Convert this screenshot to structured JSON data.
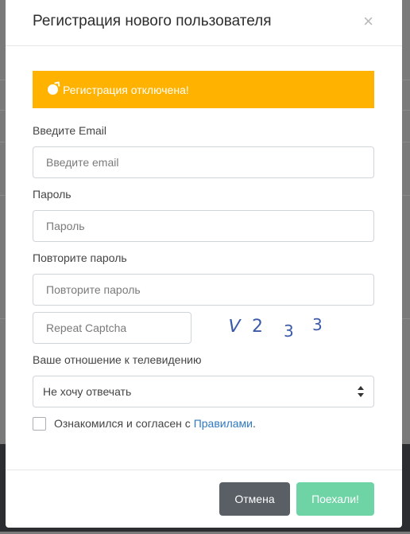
{
  "modal": {
    "title": "Регистрация нового пользователя",
    "close_label": "×"
  },
  "alert": {
    "icon": "bomb-icon",
    "text": "Регистрация отключена!",
    "color": "#ffb300"
  },
  "form": {
    "email": {
      "label": "Введите Email",
      "placeholder": "Введите email",
      "value": ""
    },
    "password": {
      "label": "Пароль",
      "placeholder": "Пароль",
      "value": ""
    },
    "password_repeat": {
      "label": "Повторите пароль",
      "placeholder": "Повторите пароль",
      "value": ""
    },
    "captcha": {
      "placeholder": "Repeat Captcha",
      "image_chars": [
        "V",
        "2",
        "3",
        "3"
      ]
    },
    "tv_attitude": {
      "label": "Ваше отношение к телевидению",
      "selected": "Не хочу отвечать"
    },
    "agreement": {
      "checked": false,
      "text_before": "Ознакомился и согласен с ",
      "link_text": "Правилами",
      "text_after": "."
    }
  },
  "footer": {
    "cancel_label": "Отмена",
    "submit_label": "Поехали!",
    "cancel_color": "#5a5f65",
    "submit_color": "#6fd4a5"
  }
}
